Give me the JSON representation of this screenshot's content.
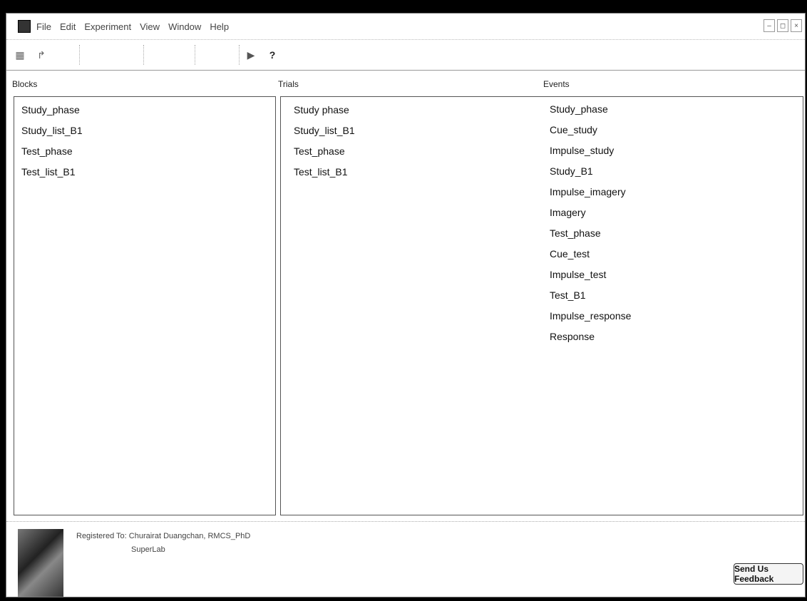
{
  "menu": [
    "File",
    "Edit",
    "Experiment",
    "View",
    "Window",
    "Help"
  ],
  "toolbar": {
    "help_label": "?"
  },
  "panels": {
    "blocks": {
      "label": "Blocks",
      "items": [
        "Study_phase",
        "Study_list_B1",
        "Test_phase",
        "Test_list_B1"
      ]
    },
    "trials": {
      "label": "Trials",
      "items": [
        "Study phase",
        "Study_list_B1",
        "Test_phase",
        "Test_list_B1"
      ]
    },
    "events": {
      "label": "Events",
      "items": [
        "Study_phase",
        "Cue_study",
        "Impulse_study",
        "Study_B1",
        "Impulse_imagery",
        "Imagery",
        "Test_phase",
        "Cue_test",
        "Impulse_test",
        "Test_B1",
        "Impulse_response",
        "Response"
      ]
    }
  },
  "status": {
    "registered": "Registered To: Churairat Duangchan, RMCS_PhD",
    "product": "SuperLab",
    "feedback_button": "Send Us Feedback"
  },
  "icons": [
    "app-icon",
    "new-icon",
    "open-icon",
    "run-icon",
    "help-icon"
  ]
}
